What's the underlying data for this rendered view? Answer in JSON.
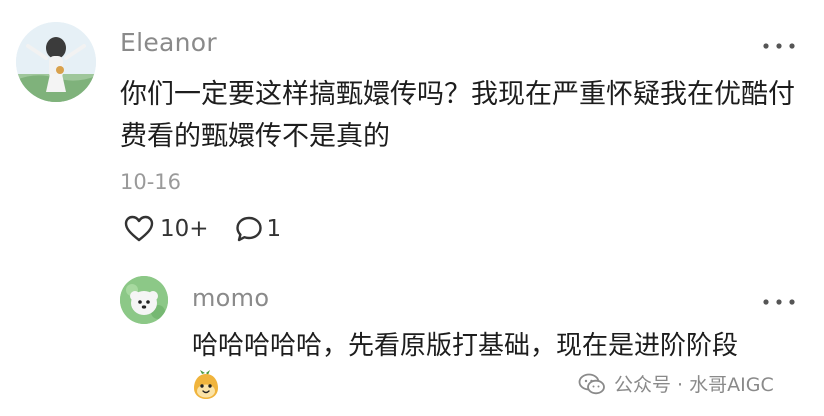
{
  "comment": {
    "author": "Eleanor",
    "text": "你们一定要这样搞甄嬛传吗？我现在严重怀疑我在优酷付费看的甄嬛传不是真的",
    "date": "10-16",
    "likes": "10+",
    "replies": "1",
    "more_icon": "more-dots-icon",
    "like_icon": "heart-outline-icon",
    "reply_icon": "speech-bubble-icon"
  },
  "reply": {
    "author": "momo",
    "text": "哈哈哈哈哈，先看原版打基础，现在是进阶阶段",
    "emoji_icon": "cute-face-emoji-icon",
    "more_icon": "more-dots-icon"
  },
  "watermark": {
    "text": "公众号 · 水哥AIGC",
    "icon": "wechat-icon"
  },
  "colors": {
    "author": "#8a8a8a",
    "body_text": "#1d1d1d",
    "meta": "#9a9a9a",
    "background": "#ffffff"
  }
}
